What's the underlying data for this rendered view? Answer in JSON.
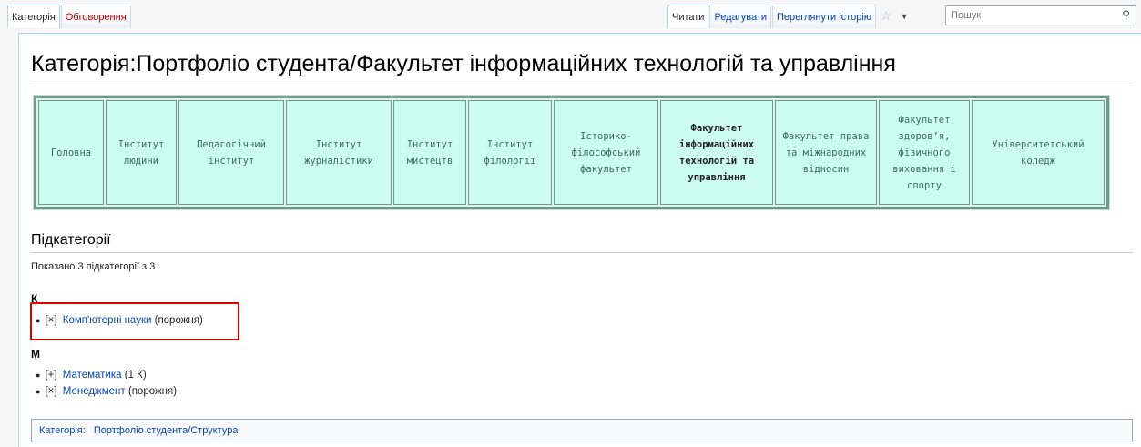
{
  "tabs_left": [
    {
      "label": "Категорія",
      "state": "selected"
    },
    {
      "label": "Обговорення",
      "state": "new"
    }
  ],
  "tabs_right": [
    {
      "label": "Читати",
      "state": "selected"
    },
    {
      "label": "Редагувати",
      "state": "link"
    },
    {
      "label": "Переглянути історію",
      "state": "link"
    }
  ],
  "icons": {
    "watch": "star-icon",
    "more": "chevron-down-icon",
    "search": "search-icon"
  },
  "search": {
    "placeholder": "Пошук",
    "value": ""
  },
  "page_title": "Категорія:Портфоліо студента/Факультет інформаційних технологій та управління",
  "nav_cells": [
    {
      "label": "Головна",
      "current": false
    },
    {
      "label": "Інститут людини",
      "current": false
    },
    {
      "label": "Педагогічний інститут",
      "current": false
    },
    {
      "label": "Інститут журналістики",
      "current": false
    },
    {
      "label": "Інститут мистецтв",
      "current": false
    },
    {
      "label": "Інститут філології",
      "current": false
    },
    {
      "label": "Історико-філософський факультет",
      "current": false
    },
    {
      "label": "Факультет інформаційних технологій та управління",
      "current": true
    },
    {
      "label": "Факультет права та міжнародних відносин",
      "current": false
    },
    {
      "label": "Факультет здоров’я, фізичного виховання і спорту",
      "current": false
    },
    {
      "label": "Університетський коледж",
      "current": false
    }
  ],
  "subcategories": {
    "heading": "Підкатегорії",
    "count_note": "Показано 3 підкатегорії з 3.",
    "groups": [
      {
        "letter": "К",
        "items": [
          {
            "toggle": "[×]",
            "name": "Комп'ютерні науки",
            "note": "(порожня)"
          }
        ]
      },
      {
        "letter": "М",
        "items": [
          {
            "toggle": "[+]",
            "name": "Математика",
            "note": "(1 К)"
          },
          {
            "toggle": "[×]",
            "name": "Менеджмент",
            "note": "(порожня)"
          }
        ]
      }
    ]
  },
  "catlinks": {
    "label": "Категорія:",
    "item": "Портфоліо студента/Структура"
  },
  "colors": {
    "link": "#0645ad",
    "new_link": "#ba0000",
    "highlight": "#e00000",
    "nav_cell": "#ccfcee",
    "nav_border": "#6d9d8a"
  }
}
